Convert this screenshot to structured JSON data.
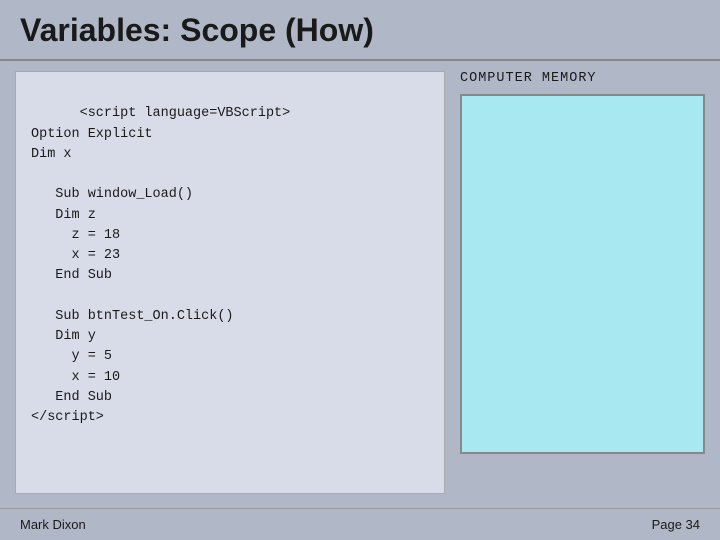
{
  "title": "Variables: Scope (How)",
  "code": {
    "lines": "<script language=VBScript>\nOption Explicit\nDim x\n\n   Sub window_Load()\n   Dim z\n     z = 18\n     x = 23\n   End Sub\n\n   Sub btnTest_On.Click()\n   Dim y\n     y = 5\n     x = 10\n   End Sub\n</script>"
  },
  "memory": {
    "label": "COMPUTER  MEMORY"
  },
  "footer": {
    "author": "Mark Dixon",
    "page": "Page 34"
  }
}
